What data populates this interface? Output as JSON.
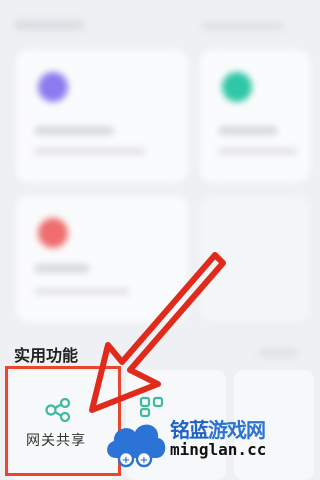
{
  "section": {
    "title": "实用功能"
  },
  "feature": {
    "label": "网关共享"
  },
  "watermark": {
    "brand_cn_part1": "铭蓝",
    "brand_cn_part2": "游戏网",
    "url": "minglan.cc"
  },
  "colors": {
    "highlight": "#e8462d",
    "arrow": "#e02a1c",
    "icon_green": "#3fb8a0",
    "brand_blue": "#2b74d6"
  }
}
